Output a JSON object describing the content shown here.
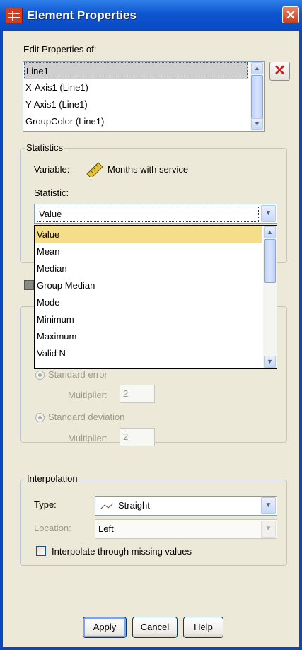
{
  "window": {
    "title": "Element Properties",
    "close_glyph": "✕"
  },
  "edit_properties": {
    "label": "Edit Properties of:",
    "items": [
      "Line1",
      "X-Axis1 (Line1)",
      "Y-Axis1 (Line1)",
      "GroupColor (Line1)"
    ],
    "selected_index": 0,
    "delete_glyph": "✕"
  },
  "statistics": {
    "legend": "Statistics",
    "variable_label": "Variable:",
    "variable_icon": "ruler-icon",
    "variable_value": "Months with service",
    "statistic_label": "Statistic:",
    "statistic_value": "Value",
    "dropdown_options": [
      "Value",
      "Mean",
      "Median",
      "Group Median",
      "Mode",
      "Minimum",
      "Maximum",
      "Valid N"
    ],
    "highlighted_index": 0
  },
  "error_bars": {
    "standard_error_label": "Standard error",
    "multiplier_label": "Multiplier:",
    "se_multiplier": "2",
    "standard_deviation_label": "Standard deviation",
    "sd_multiplier_label": "Multiplier:",
    "sd_multiplier": "2"
  },
  "interpolation": {
    "legend": "Interpolation",
    "type_label": "Type:",
    "type_value": "Straight",
    "type_icon": "straight-line-icon",
    "location_label": "Location:",
    "location_value": "Left",
    "checkbox_label": "Interpolate through missing values",
    "checkbox_checked": false
  },
  "buttons": {
    "apply": "Apply",
    "cancel": "Cancel",
    "help": "Help"
  },
  "colors": {
    "title_bar": "#0a48c3",
    "dialog_bg": "#ece9d8",
    "highlight": "#f5de8a",
    "delete_red": "#cc1c1c"
  }
}
